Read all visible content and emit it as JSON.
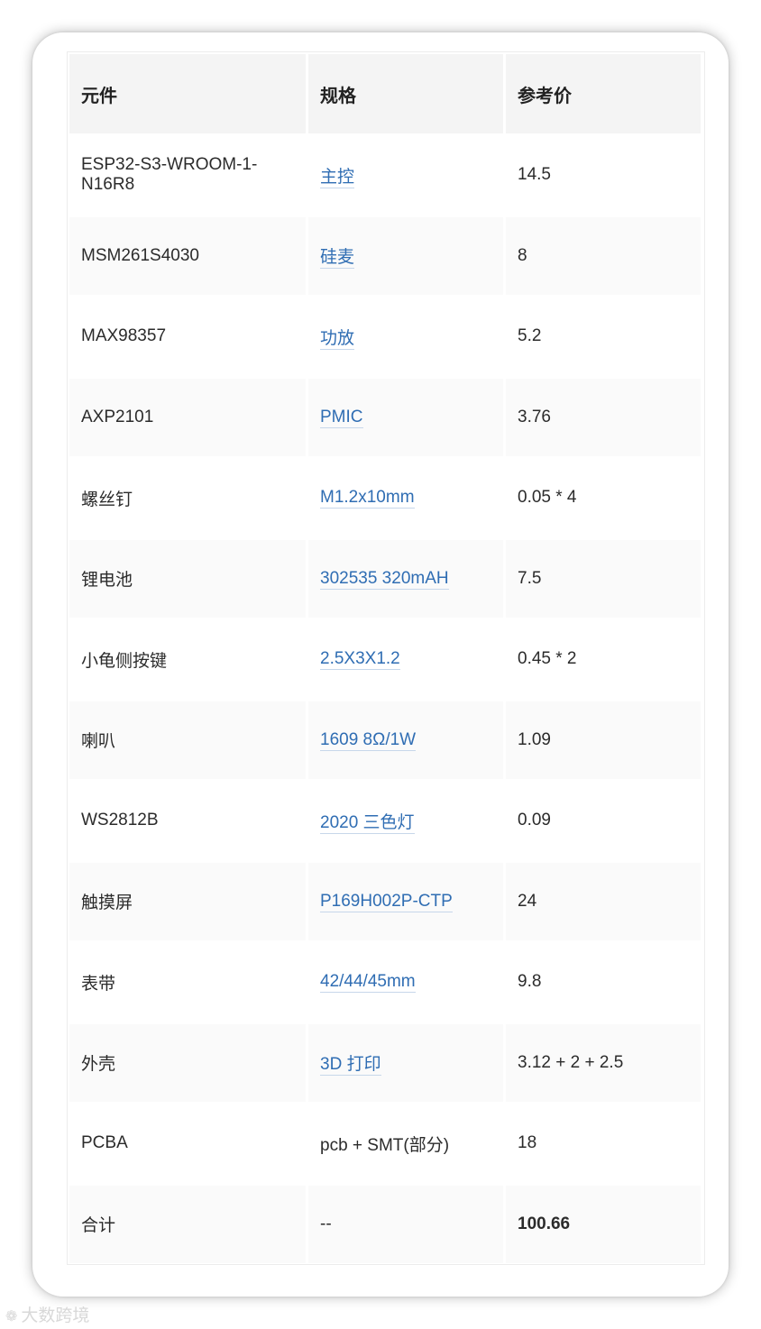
{
  "table": {
    "headers": [
      "元件",
      "规格",
      "参考价"
    ],
    "rows": [
      {
        "component": "ESP32-S3-WROOM-1-N16R8",
        "spec": "主控",
        "price": "14.5"
      },
      {
        "component": "MSM261S4030",
        "spec": "硅麦",
        "price": "8"
      },
      {
        "component": "MAX98357",
        "spec": "功放",
        "price": "5.2"
      },
      {
        "component": "AXP2101",
        "spec": "PMIC",
        "price": "3.76"
      },
      {
        "component": "螺丝钉",
        "spec": "M1.2x10mm",
        "price": "0.05 * 4"
      },
      {
        "component": "锂电池",
        "spec": "302535 320mAH",
        "price": "7.5"
      },
      {
        "component": "小龟侧按键",
        "spec": "2.5X3X1.2",
        "price": "0.45 * 2"
      },
      {
        "component": "喇叭",
        "spec": "1609 8Ω/1W",
        "price": "1.09"
      },
      {
        "component": "WS2812B",
        "spec": "2020 三色灯",
        "price": "0.09"
      },
      {
        "component": "触摸屏",
        "spec": "P169H002P-CTP",
        "price": "24"
      },
      {
        "component": "表带",
        "spec": "42/44/45mm",
        "price": "9.8"
      },
      {
        "component": "外壳",
        "spec": "3D 打印",
        "price": "3.12 + 2 + 2.5"
      },
      {
        "component": "PCBA",
        "spec": "pcb + SMT(部分)",
        "price": "18"
      },
      {
        "component": "合计",
        "spec": "--",
        "price": "100.66"
      }
    ]
  },
  "watermark": {
    "text": "大数跨境",
    "icon": "logo-swirl-icon"
  },
  "colors": {
    "link": "#2f6db3",
    "header_bg": "#f4f4f4",
    "text": "#2b2b2b"
  }
}
